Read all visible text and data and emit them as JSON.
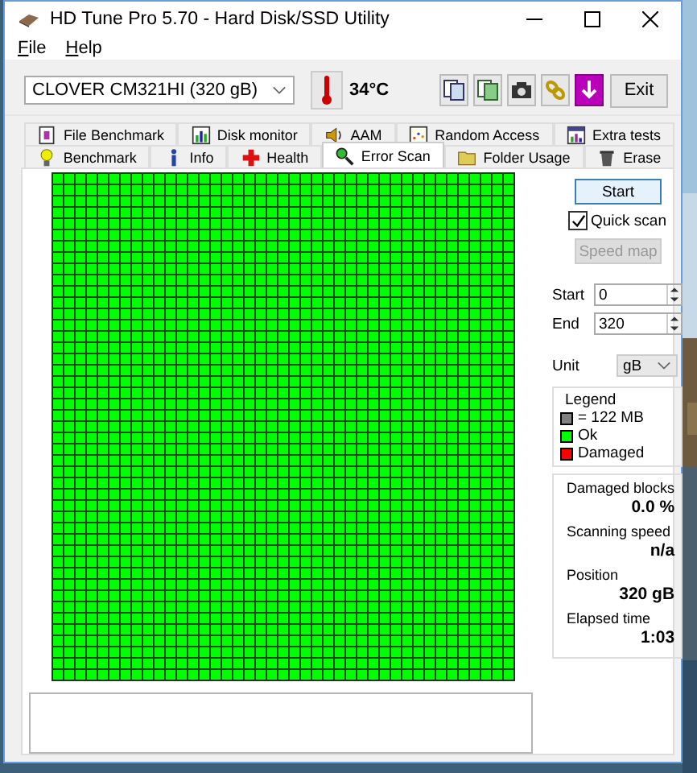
{
  "window": {
    "title": "HD Tune Pro 5.70 - Hard Disk/SSD Utility"
  },
  "menu": [
    {
      "label": "File"
    },
    {
      "label": "Help"
    }
  ],
  "toolbar": {
    "drive": "CLOVER  CM321HI (320 gB)",
    "temperature": "34°C",
    "exit": "Exit"
  },
  "tabs_top": [
    {
      "label": "File Benchmark",
      "kind": "file",
      "selected": false
    },
    {
      "label": "Disk monitor",
      "kind": "monitor",
      "selected": false
    },
    {
      "label": "AAM",
      "kind": "speaker",
      "selected": false
    },
    {
      "label": "Random Access",
      "kind": "scatter",
      "selected": false
    },
    {
      "label": "Extra tests",
      "kind": "extra",
      "selected": false
    }
  ],
  "tabs_bottom": [
    {
      "label": "Benchmark",
      "kind": "bulb",
      "selected": false
    },
    {
      "label": "Info",
      "kind": "info",
      "selected": false
    },
    {
      "label": "Health",
      "kind": "cross",
      "selected": false
    },
    {
      "label": "Error Scan",
      "kind": "magnifier",
      "selected": true
    },
    {
      "label": "Folder Usage",
      "kind": "folder",
      "selected": false
    },
    {
      "label": "Erase",
      "kind": "bin",
      "selected": false
    }
  ],
  "controls": {
    "start": "Start",
    "quick_scan": {
      "label": "Quick scan",
      "checked": true
    },
    "speed_map": {
      "label": "Speed map",
      "disabled": true
    },
    "start_field": {
      "label": "Start",
      "value": "0"
    },
    "end_field": {
      "label": "End",
      "value": "320"
    },
    "unit": {
      "label": "Unit",
      "value": "gB"
    }
  },
  "legend": {
    "title": "Legend",
    "items": [
      {
        "label": "= 122 MB",
        "color": "#808080"
      },
      {
        "label": "Ok",
        "color": "#00ff00"
      },
      {
        "label": "Damaged",
        "color": "#ff0000"
      }
    ]
  },
  "stats": [
    {
      "label": "Damaged blocks",
      "value": "0.0 %"
    },
    {
      "label": "Scanning speed",
      "value": "n/a"
    },
    {
      "label": "Position",
      "value": "320 gB"
    },
    {
      "label": "Elapsed time",
      "value": "1:03"
    }
  ]
}
